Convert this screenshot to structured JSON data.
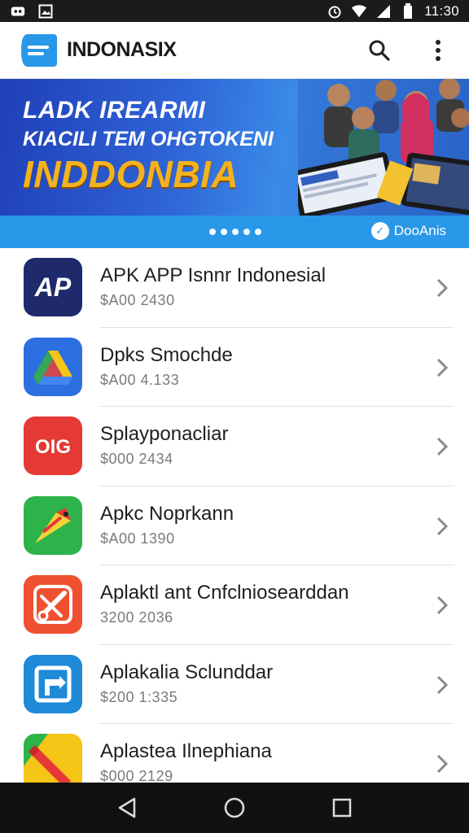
{
  "status_bar": {
    "time": "11:30",
    "left_icons": [
      "app-notification-icon",
      "image-notification-icon"
    ],
    "right_icons": [
      "alarm-icon",
      "wifi-icon",
      "signal-icon",
      "battery-icon"
    ]
  },
  "app_bar": {
    "title": "INDONASIX",
    "actions": [
      "search-icon",
      "more-vert-icon"
    ],
    "accent": "#2a98e8"
  },
  "banner": {
    "line1": "LADK IREARMI",
    "line2": "KIACILI  TEM OHGTOKENI",
    "line3": "INDDONBIA",
    "carousel_dots": 5,
    "brand": "DooAnis"
  },
  "apps": [
    {
      "name": "APK APP Isnnr Indonesial",
      "sub": "$A00  2430",
      "icon": "ap-logo-icon",
      "color": "#1e2a6b"
    },
    {
      "name": "Dpks Smochde",
      "sub": "$A00  4.133",
      "icon": "drive-icon",
      "color": "#2c6fe0"
    },
    {
      "name": "Splayponacliar",
      "sub": "$000  2434",
      "icon": "oig-logo-icon",
      "color": "#e53935"
    },
    {
      "name": "Apkc Noprkann",
      "sub": "$A00  1390",
      "icon": "parrot-icon",
      "color": "#2db34a"
    },
    {
      "name": "Aplaktl ant Cnfclniosearddan",
      "sub": "3200  2036",
      "icon": "scissors-icon",
      "color": "#ef5130"
    },
    {
      "name": "Aplakalia Sclunddar",
      "sub": "$200  1:335",
      "icon": "cast-icon",
      "color": "#1e8ad8"
    },
    {
      "name": "Aplastea Ilnephiana",
      "sub": "$000  2129",
      "icon": "pencil-icon",
      "color": "#f5c518"
    }
  ],
  "nav": [
    "back-icon",
    "home-icon",
    "recents-icon"
  ]
}
